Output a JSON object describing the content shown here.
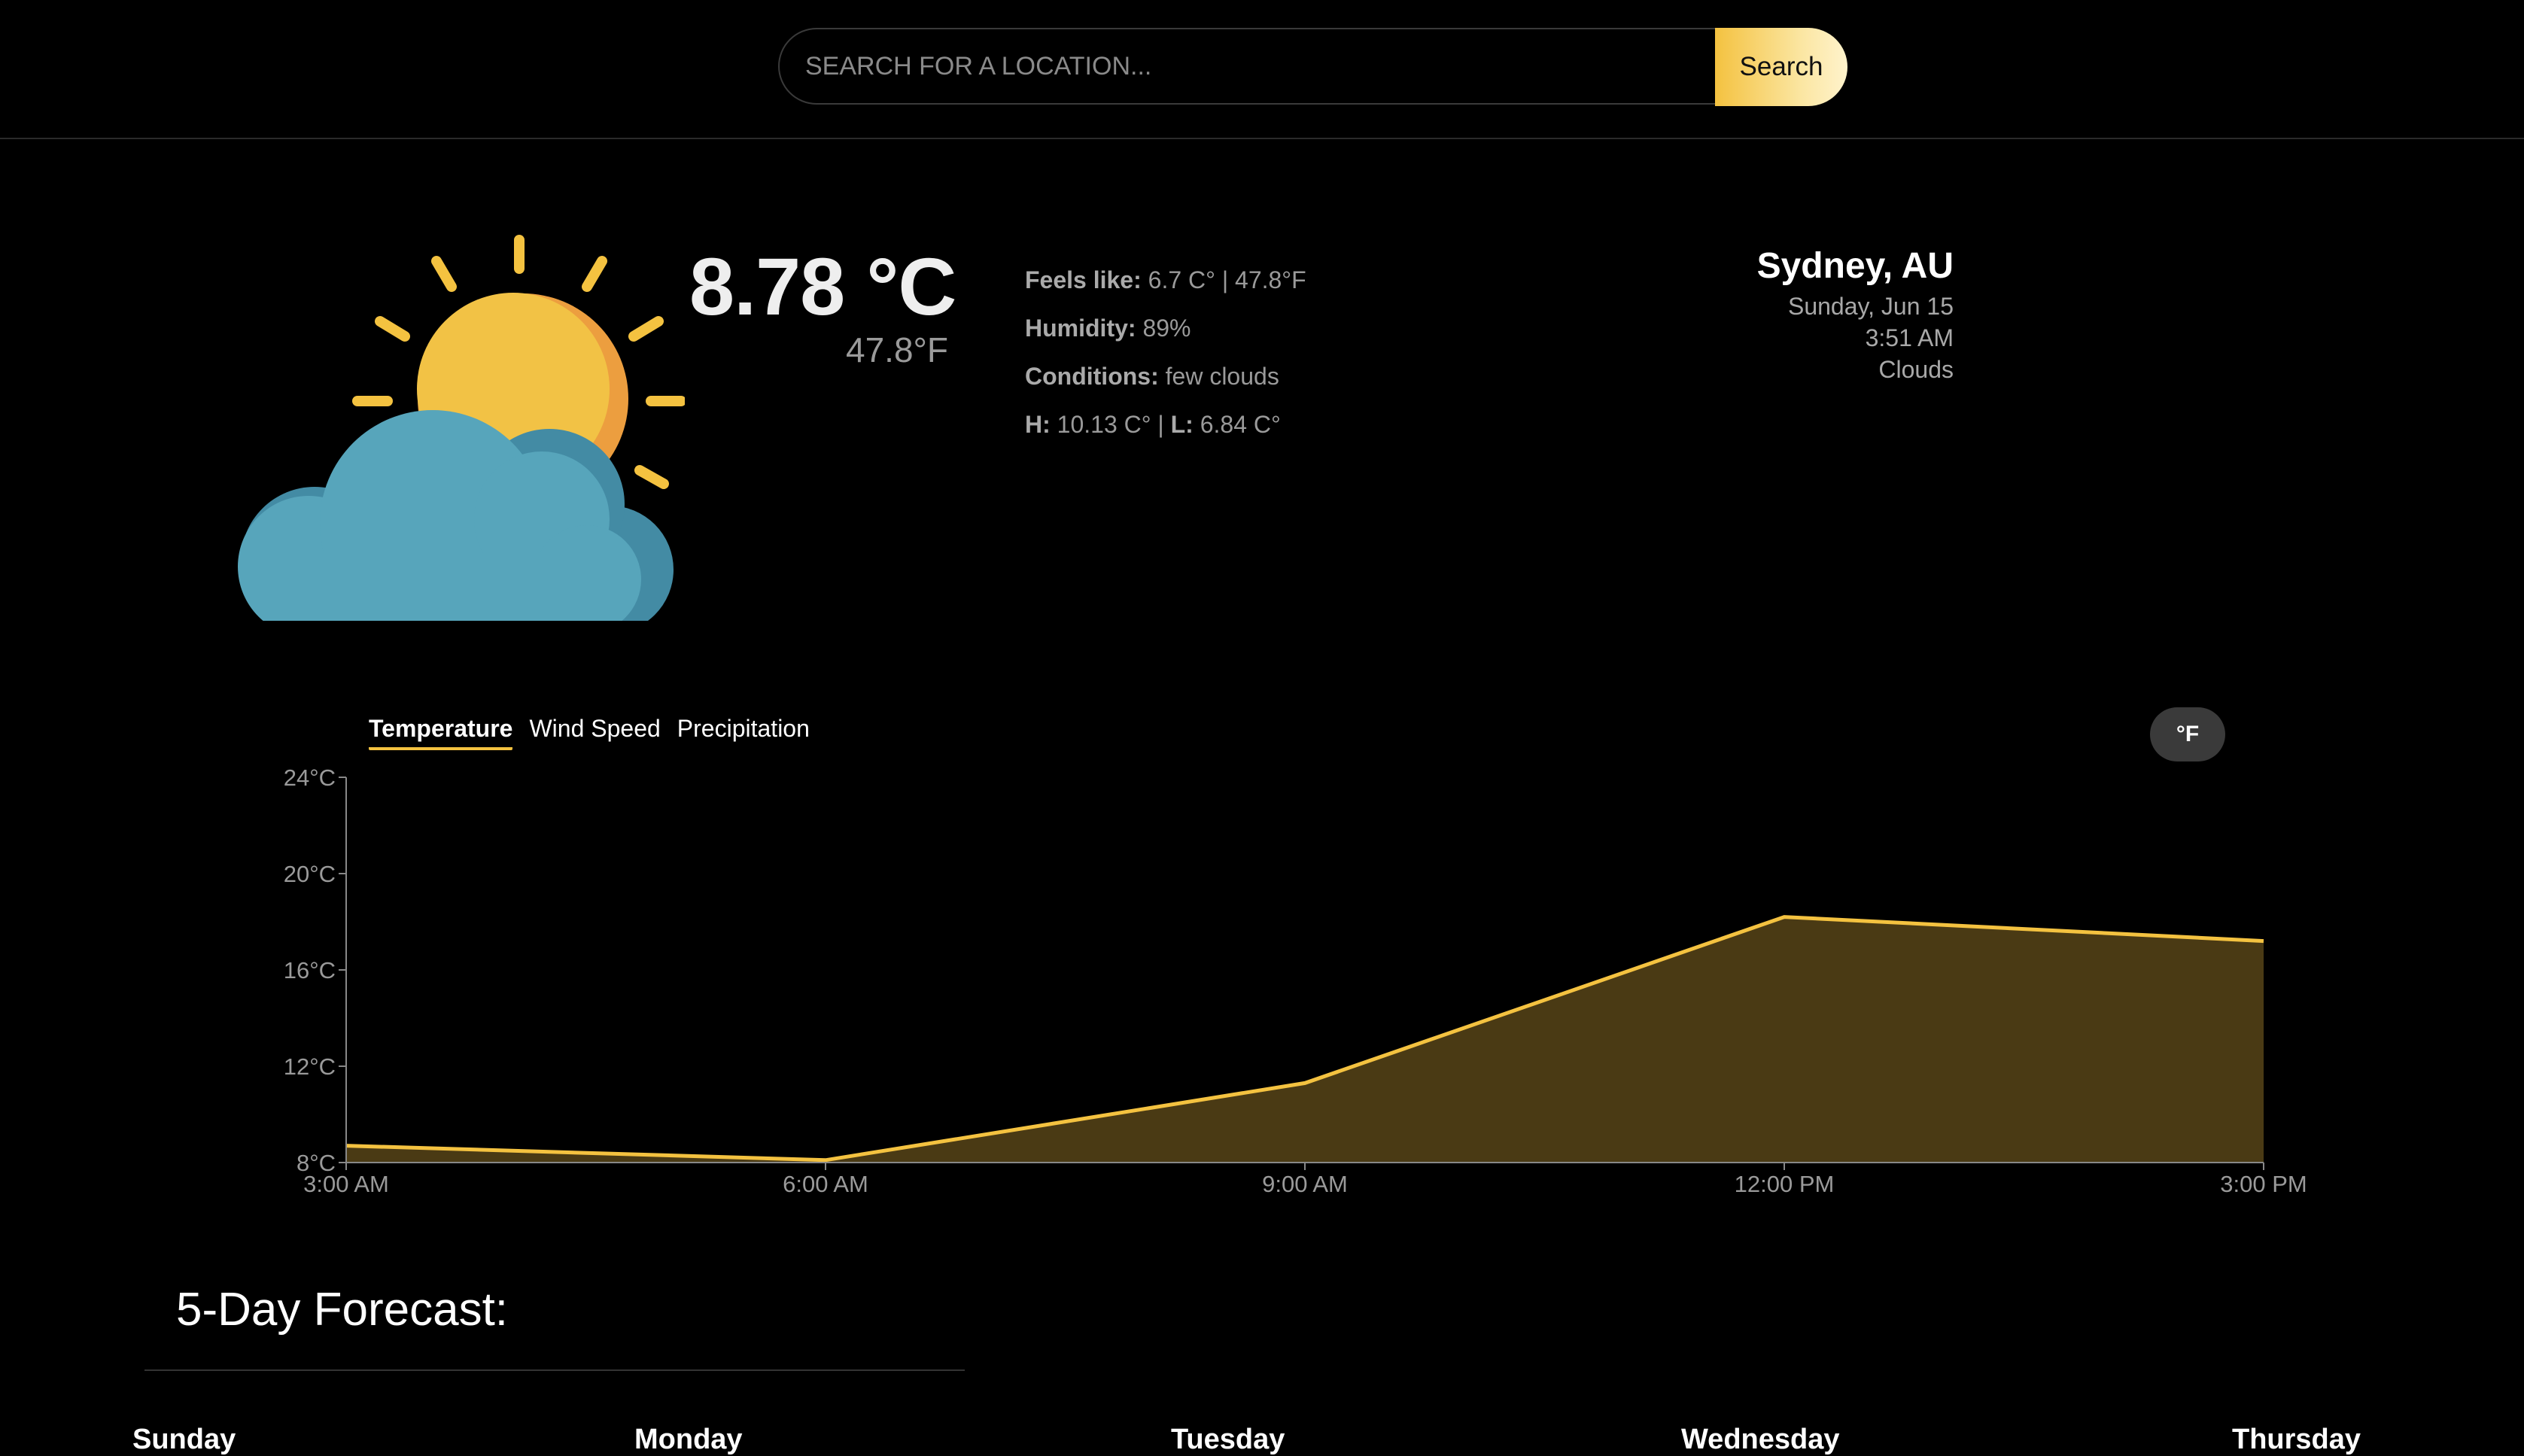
{
  "search": {
    "placeholder": "SEARCH FOR A LOCATION...",
    "button_label": "Search"
  },
  "current": {
    "temp_c": "8.78 °C",
    "temp_f": "47.8°F",
    "icon": "partly-cloudy-icon",
    "details": [
      {
        "label": "Feels like:",
        "value": " 6.7 C° | 47.8°F"
      },
      {
        "label": "Humidity:",
        "value": " 89%"
      },
      {
        "label": "Conditions:",
        "value": " few clouds"
      }
    ],
    "hl": {
      "h_label": "H:",
      "h_value": " 10.13 C° | ",
      "l_label": "L:",
      "l_value": " 6.84 C°"
    }
  },
  "location": {
    "city": "Sydney, AU",
    "date": "Sunday, Jun 15",
    "time": "3:51 AM",
    "condition": "Clouds"
  },
  "chart_tabs": [
    "Temperature",
    "Wind Speed",
    "Precipitation"
  ],
  "unit_toggle": "°F",
  "chart_data": {
    "type": "area",
    "x": [
      "3:00 AM",
      "6:00 AM",
      "9:00 AM",
      "12:00 PM",
      "3:00 PM"
    ],
    "series": [
      {
        "values": [
          8.7,
          8.1,
          11.3,
          18.2,
          17.2
        ]
      }
    ],
    "yticks": [
      "8°C",
      "12°C",
      "16°C",
      "20°C",
      "24°C"
    ],
    "ylim": [
      8,
      24
    ],
    "line_color": "#f4c240",
    "fill_color": "#4a3a14"
  },
  "forecast": {
    "title": "5-Day Forecast:",
    "days": [
      "Sunday",
      "Monday",
      "Tuesday",
      "Wednesday",
      "Thursday"
    ]
  },
  "colors": {
    "accent": "#f4c240",
    "background": "#000000"
  }
}
